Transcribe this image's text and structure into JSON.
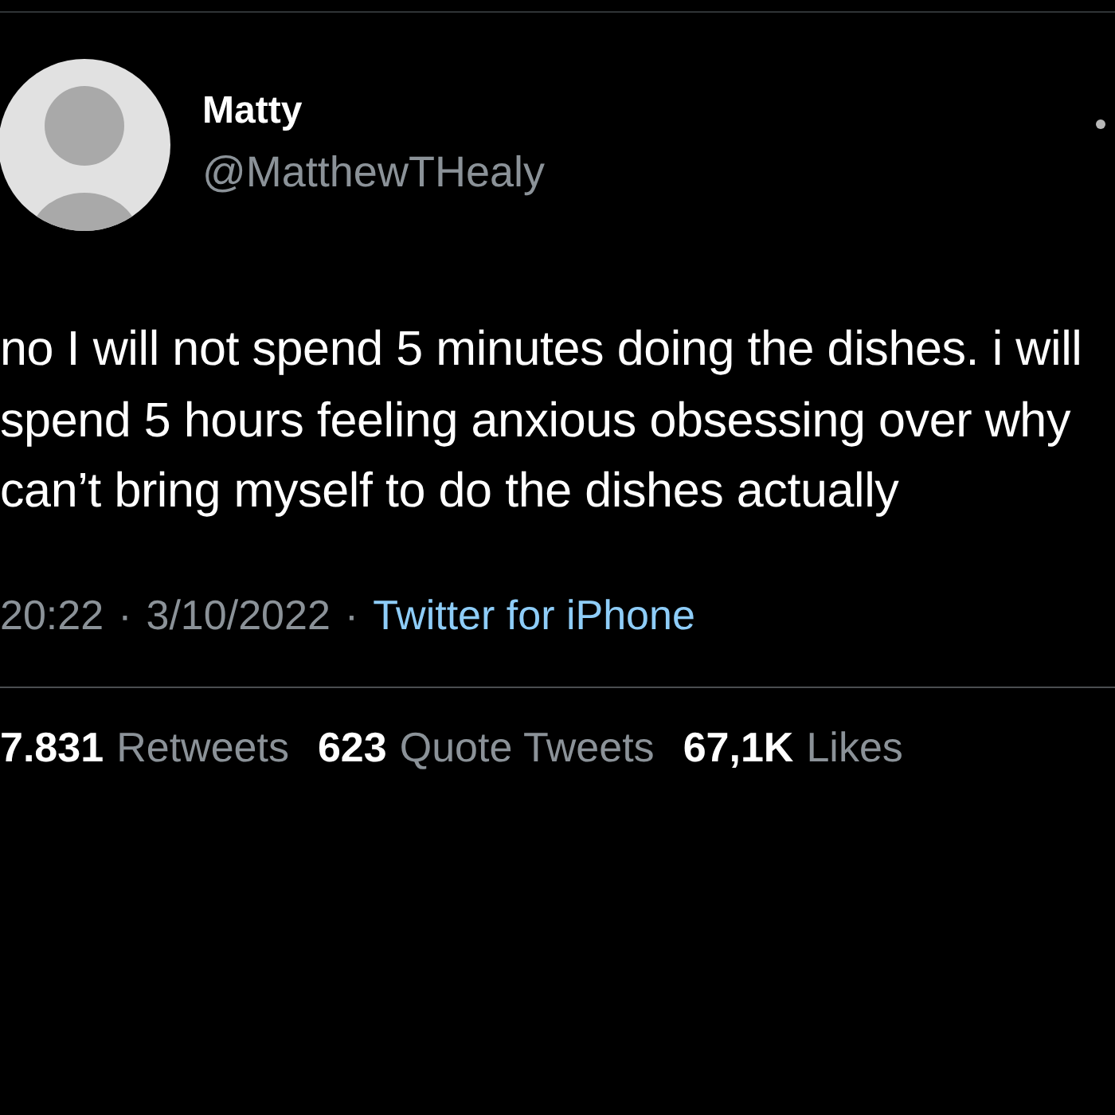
{
  "author": {
    "name": "Matty",
    "handle": "@MatthewTHealy"
  },
  "text": "no I will not spend 5 minutes doing the dishes. i will spend 5 hours feeling anxious obsessing over why can’t bring myself to do the dishes actually",
  "meta": {
    "time": "20:22",
    "separator_1": "·",
    "date": "3/10/2022",
    "separator_2": "·",
    "source": "Twitter for iPhone"
  },
  "stats": [
    {
      "count": "7.831",
      "label": "Retweets"
    },
    {
      "count": "623",
      "label": "Quote Tweets"
    },
    {
      "count": "67,1K",
      "label": "Likes"
    }
  ]
}
